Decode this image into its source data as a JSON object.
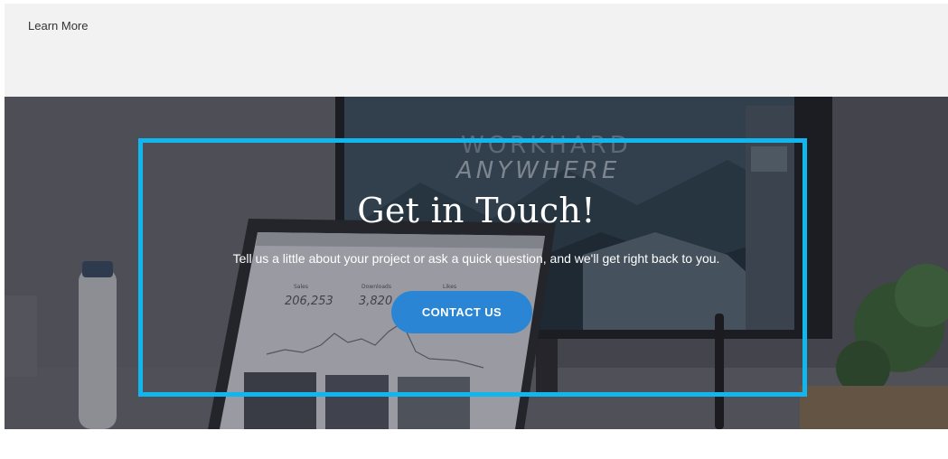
{
  "header": {
    "learn_more": "Learn More"
  },
  "hero": {
    "title": "Get in Touch!",
    "subtitle": "Tell us a little about your project or ask a quick question, and we'll get right back to you.",
    "button_label": "CONTACT US",
    "monitor_text_line1": "WORKHARD",
    "monitor_text_line2": "ANYWHERE",
    "stat1_label": "Sales",
    "stat1_value": "206,253",
    "stat2_label": "Downloads",
    "stat2_value": "3,820",
    "stat3_label": "Likes"
  },
  "colors": {
    "highlight_border": "#12b6ee",
    "button_bg": "#2a86d4",
    "top_band_bg": "#f2f2f2"
  }
}
